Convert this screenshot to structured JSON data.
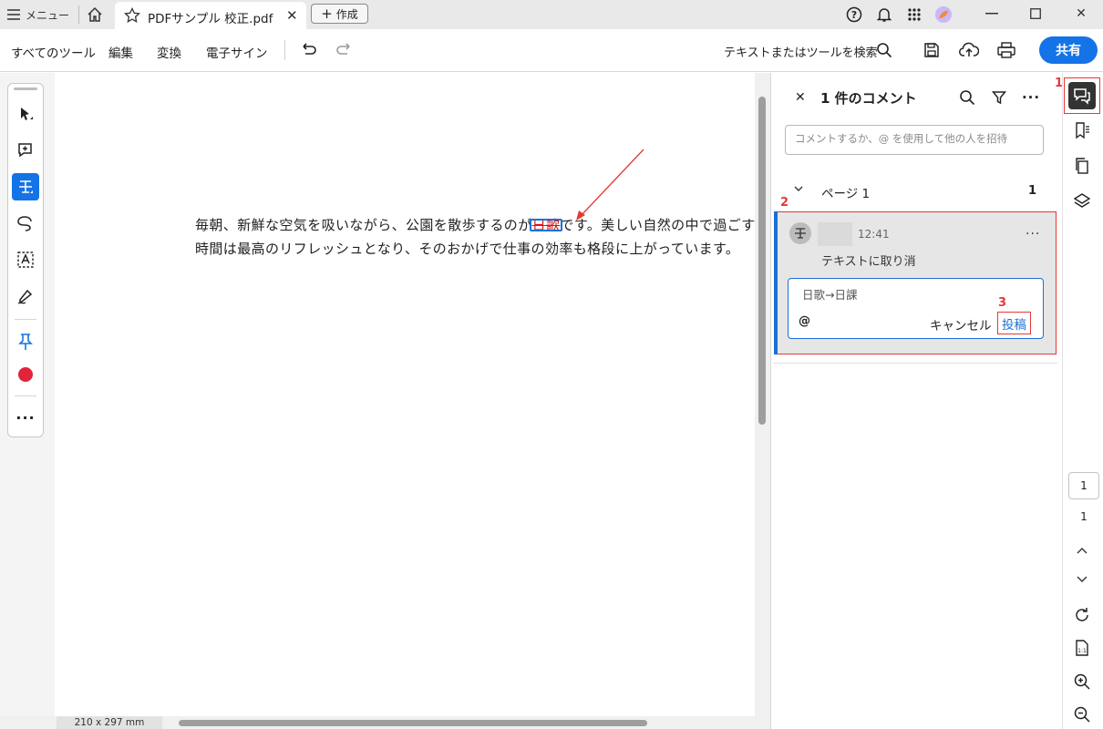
{
  "titlebar": {
    "menu_label": "メニュー",
    "tab_title": "PDFサンプル 校正.pdf",
    "create_label": "作成"
  },
  "toolbar": {
    "all_tools": "すべてのツール",
    "edit": "編集",
    "convert": "変換",
    "esign": "電子サイン",
    "search_label": "テキストまたはツールを検索",
    "share": "共有"
  },
  "document": {
    "text_before": "毎朝、新鮮な空気を吸いながら、公園を散歩するのが",
    "struck_text": "日歌",
    "text_after": "です。美しい自然の中で過ごす時間は最高のリフレッシュとなり、そのおかげで仕事の効率も格段に上がっています。",
    "page_size": "210 x 297 mm"
  },
  "comments_panel": {
    "title": "1 件のコメント",
    "input_placeholder": "コメントするか、@ を使用して他の人を招待",
    "page_label": "ページ 1",
    "page_count": "1",
    "comment": {
      "time": "12:41",
      "text": "テキストに取り消",
      "reply_value": "日歌→日課",
      "at_symbol": "@",
      "cancel": "キャンセル",
      "post": "投稿"
    }
  },
  "markers": [
    "1",
    "2",
    "3"
  ],
  "page_nav": {
    "current": "1",
    "total": "1"
  },
  "colors": {
    "accent": "#1473e6",
    "strike": "#dd1111",
    "annotation_red": "#e53935"
  }
}
